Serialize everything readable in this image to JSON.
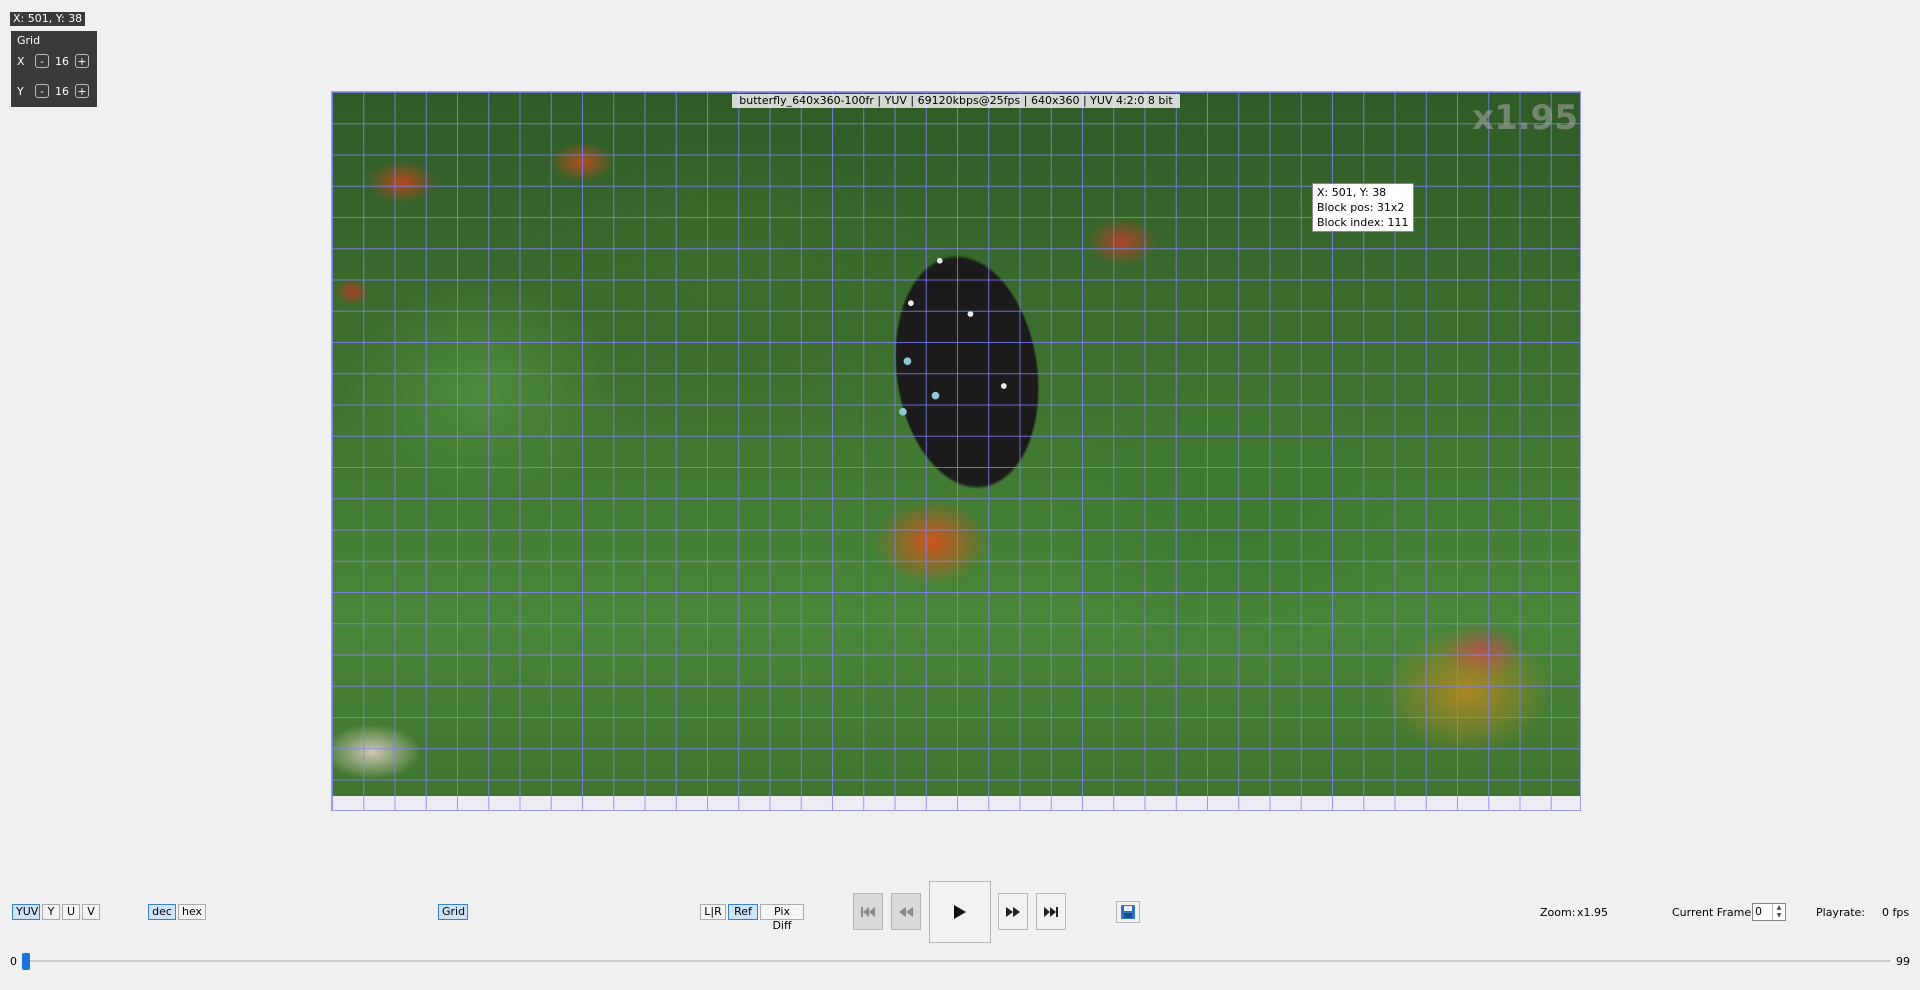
{
  "cursor_readout": "X: 501, Y: 38",
  "grid_panel": {
    "title": "Grid",
    "x_label": "X",
    "y_label": "Y",
    "x_value": "16",
    "y_value": "16",
    "minus": "-",
    "plus": "+"
  },
  "viewer": {
    "info_banner": "butterfly_640x360-100fr | YUV | 69120kbps@25fps | 640x360 | YUV 4:2:0 8 bit",
    "zoom_watermark": "x1.95",
    "tooltip": {
      "line1": "X: 501, Y: 38",
      "line2": "Block pos: 31x2",
      "line3": "Block index: 111"
    }
  },
  "toolbar": {
    "plane_buttons": [
      "YUV",
      "Y",
      "U",
      "V"
    ],
    "active_plane": "YUV",
    "format_buttons": [
      "dec",
      "hex"
    ],
    "active_format": "dec",
    "grid_button": "Grid",
    "compare_buttons": [
      "L|R",
      "Ref",
      "Pix Diff"
    ],
    "active_compare": "Ref",
    "zoom_label": "Zoom:",
    "zoom_value": "x1.95",
    "frame_label": "Current Frame:",
    "frame_value": "0",
    "playrate_label": "Playrate:",
    "playrate_value": "0 fps"
  },
  "icons": {
    "first": "skip-to-start-icon",
    "prev": "rewind-icon",
    "play": "play-icon",
    "next": "fast-forward-icon",
    "last": "skip-to-end-icon",
    "save": "save-icon"
  },
  "timeline": {
    "min": "0",
    "max": "99",
    "current": 0
  }
}
